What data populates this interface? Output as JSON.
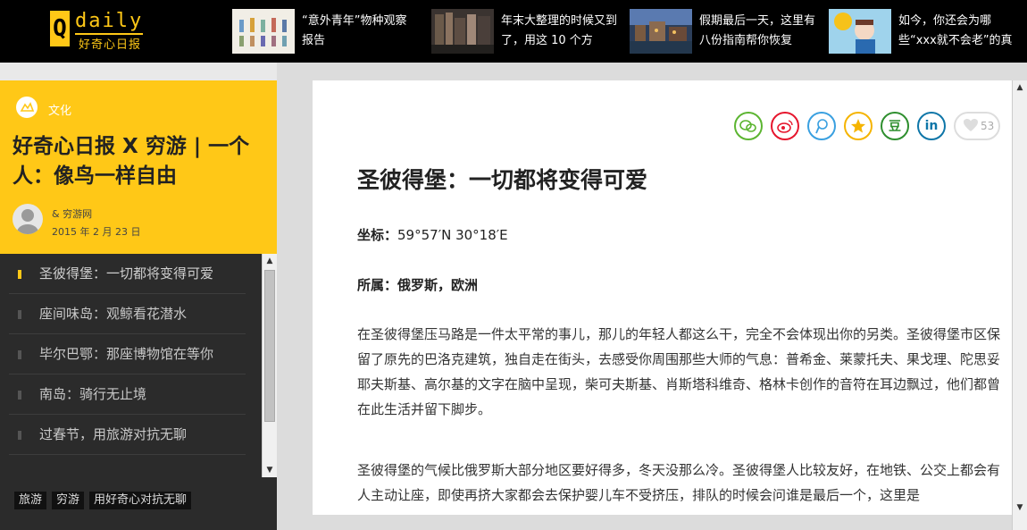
{
  "logo": {
    "q": "Q",
    "word": "daily",
    "cn": "好奇心日报"
  },
  "top_news": [
    {
      "text": "“意外青年”物种观察报告"
    },
    {
      "text": "年末大整理的时候又到了，用这 10 个方"
    },
    {
      "text": "假期最后一天，这里有八份指南帮你恢复"
    },
    {
      "text": "如今，你还会为哪些“xxx就不会老”的真"
    }
  ],
  "side": {
    "category": "文化",
    "title": "好奇心日报 X 穷游 | 一个人：像鸟一样自由",
    "author": "& 穷游网",
    "date": "2015 年 2 月 23 日",
    "items": [
      {
        "label": "圣彼得堡：一切都将变得可爱",
        "active": true
      },
      {
        "label": "座间味岛：观鲸看花潜水"
      },
      {
        "label": "毕尔巴鄂：那座博物馆在等你"
      },
      {
        "label": "南岛：骑行无止境"
      },
      {
        "label": "过春节，用旅游对抗无聊"
      }
    ],
    "tags": [
      "旅游",
      "穷游",
      "用好奇心对抗无聊"
    ]
  },
  "article": {
    "title": "圣彼得堡：一切都将变得可爱",
    "coord_label": "坐标：",
    "coord_value": "59°57′N 30°18′E",
    "belong_label": "所属：俄罗斯，欧洲",
    "p1": "在圣彼得堡压马路是一件太平常的事儿，那儿的年轻人都这么干，完全不会体现出你的另类。圣彼得堡市区保留了原先的巴洛克建筑，独自走在街头，去感受你周围那些大师的气息：普希金、莱蒙托夫、果戈理、陀思妥耶夫斯基、高尔基的文字在脑中呈现，柴可夫斯基、肖斯塔科维奇、格林卡创作的音符在耳边飘过，他们都曾在此生活并留下脚步。",
    "p2": "圣彼得堡的气候比俄罗斯大部分地区要好得多，冬天没那么冷。圣彼得堡人比较友好，在地铁、公交上都会有人主动让座，即使再挤大家都会去保护婴儿车不受挤压，排队的时候会问谁是最后一个，这里是",
    "like_count": "53"
  },
  "share_icons": [
    {
      "name": "wechat-share-icon",
      "glyph": "◎",
      "color": "#5cb531"
    },
    {
      "name": "weibo-share-icon",
      "glyph": "◉",
      "color": "#e6162d"
    },
    {
      "name": "tencent-share-icon",
      "glyph": "ρ",
      "color": "#3aa0e0"
    },
    {
      "name": "qzone-share-icon",
      "glyph": "★",
      "color": "#f5b400"
    },
    {
      "name": "douban-share-icon",
      "glyph": "豆",
      "color": "#2f8f2f"
    },
    {
      "name": "linkedin-share-icon",
      "glyph": "in",
      "color": "#0e76a8"
    }
  ],
  "accent": "#ffc817"
}
